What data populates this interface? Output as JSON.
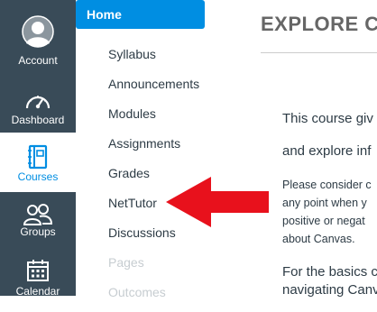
{
  "global_nav": {
    "account": {
      "label": "Account",
      "icon": "account-avatar-icon"
    },
    "dashboard": {
      "label": "Dashboard",
      "icon": "speedometer-icon"
    },
    "courses": {
      "label": "Courses",
      "icon": "book-icon"
    },
    "groups": {
      "label": "Groups",
      "icon": "people-icon"
    },
    "calendar": {
      "label": "Calendar",
      "icon": "calendar-icon"
    }
  },
  "course_nav": {
    "items": [
      {
        "label": "Home",
        "active": true
      },
      {
        "label": "Syllabus"
      },
      {
        "label": "Announcements"
      },
      {
        "label": "Modules"
      },
      {
        "label": "Assignments"
      },
      {
        "label": "Grades"
      },
      {
        "label": "NetTutor"
      },
      {
        "label": "Discussions"
      },
      {
        "label": "Pages",
        "disabled": true
      },
      {
        "label": "Outcomes",
        "disabled": true
      }
    ]
  },
  "main": {
    "title": "EXPLORE C",
    "paragraphs": [
      "This course giv",
      "and explore inf",
      "Please consider c",
      "any point when y",
      "positive or negat",
      "about Canvas.",
      "For the basics c",
      "navigating Canv"
    ]
  },
  "colors": {
    "global_nav_bg": "#394b58",
    "accent_blue": "#008ee2",
    "arrow_red": "#e8111c"
  }
}
